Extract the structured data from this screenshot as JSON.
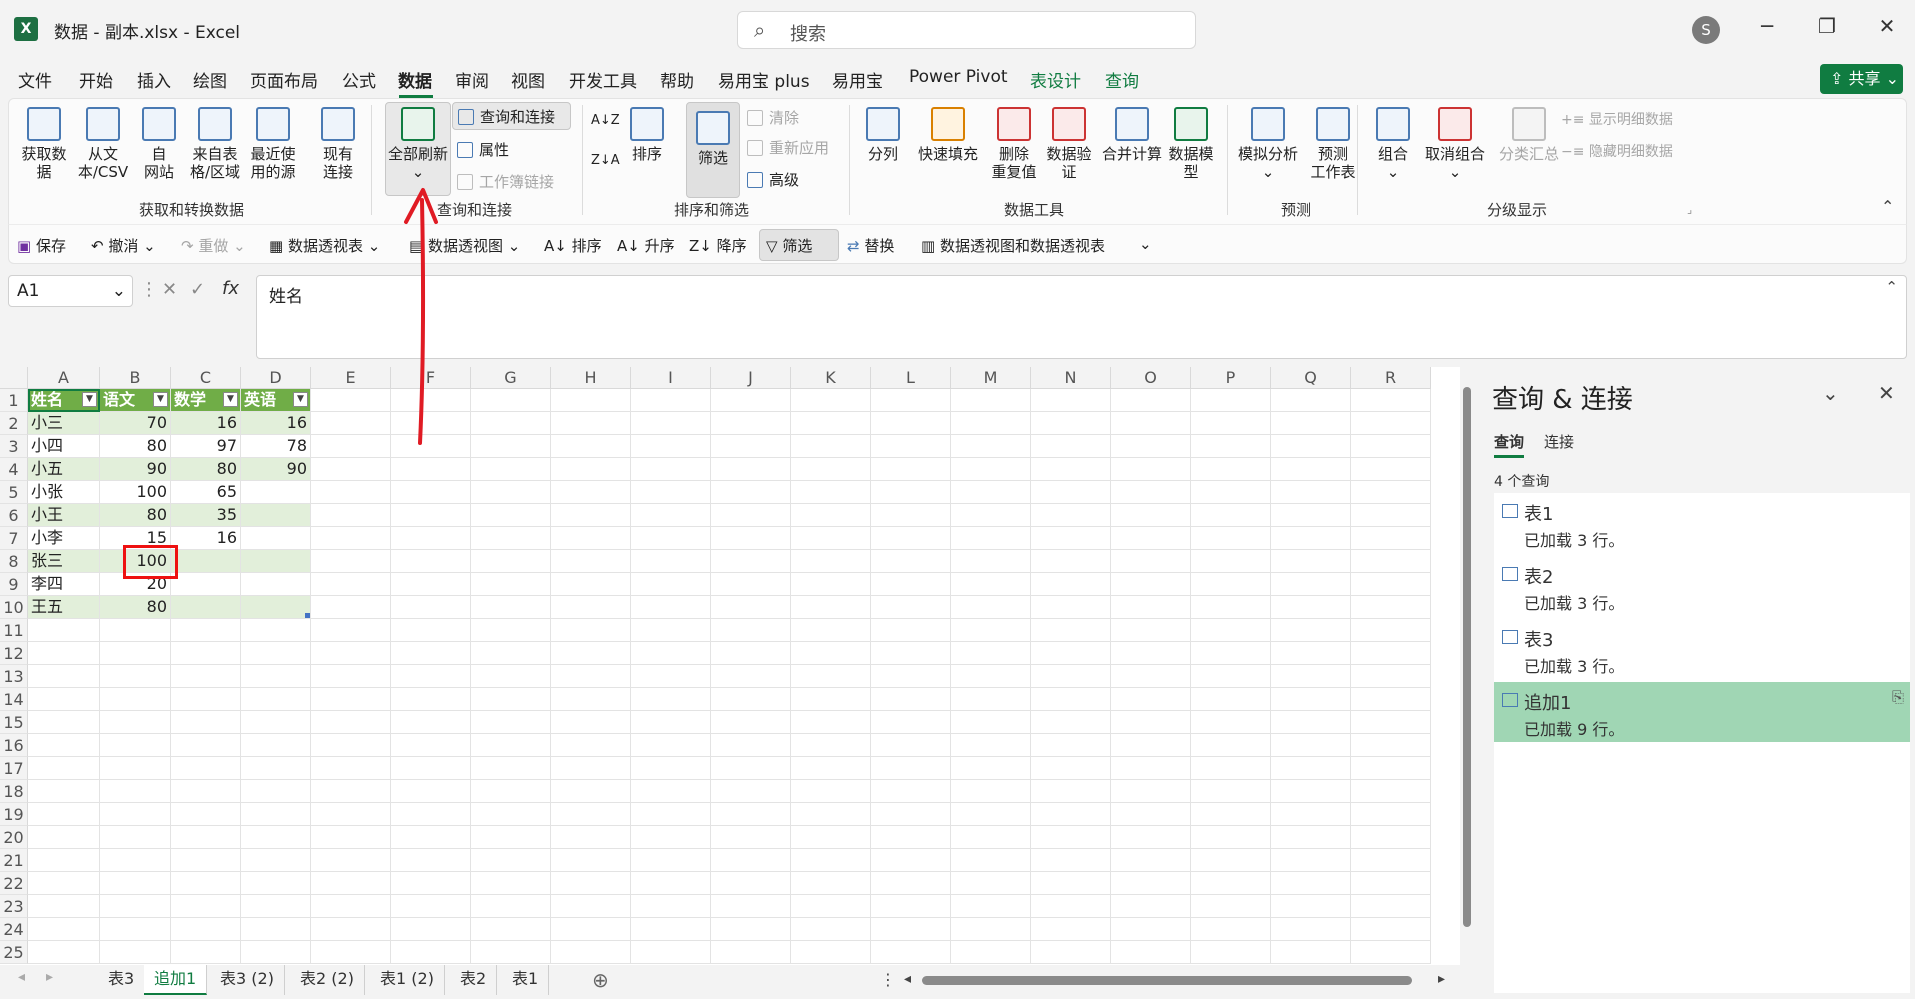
{
  "title_bar": {
    "app_logo": "X",
    "window_title": "数据 - 副本.xlsx  -  Excel",
    "search_placeholder": "搜索",
    "user_initial": "S",
    "minimize": "─",
    "restore": "❐",
    "close": "✕"
  },
  "menu": {
    "tabs": [
      "文件",
      "开始",
      "插入",
      "绘图",
      "页面布局",
      "公式",
      "数据",
      "审阅",
      "视图",
      "开发工具",
      "帮助",
      "易用宝 plus",
      "易用宝",
      "Power Pivot",
      "表设计",
      "查询"
    ],
    "active_tab": "数据",
    "share_label": "共享"
  },
  "ribbon": {
    "get_data": "获取数\n据",
    "from_text_csv": "从文\n本/CSV",
    "from_web": "自\n网站",
    "from_table": "来自表\n格/区域",
    "recent_sources": "最近使\n用的源",
    "existing_conn": "现有\n连接",
    "group_get": "获取和转换数据",
    "refresh_all": "全部刷新",
    "queries_connections": "查询和连接",
    "properties": "属性",
    "workbook_links": "工作簿链接",
    "group_query": "查询和连接",
    "sort": "排序",
    "filter": "筛选",
    "clear": "清除",
    "reapply": "重新应用",
    "advanced": "高级",
    "group_sort": "排序和筛选",
    "text_to_columns": "分列",
    "flash_fill": "快速填充",
    "remove_duplicates": "删除\n重复值",
    "data_validation": "数据验\n证",
    "consolidate": "合并计算",
    "data_model": "数据模\n型",
    "group_tools": "数据工具",
    "what_if": "模拟分析",
    "forecast_sheet": "预测\n工作表",
    "group_forecast": "预测",
    "group_btn": "组合",
    "ungroup_btn": "取消组合",
    "subtotal": "分类汇总",
    "show_detail": "显示明细数据",
    "hide_detail": "隐藏明细数据",
    "group_outline": "分级显示"
  },
  "qat": {
    "save": "保存",
    "undo": "撤消",
    "redo": "重做",
    "pivot_table": "数据透视表",
    "pivot_chart": "数据透视图",
    "sort": "排序",
    "sort_asc": "升序",
    "sort_desc": "降序",
    "filter": "筛选",
    "replace": "替换",
    "pivot_combo": "数据透视图和数据透视表"
  },
  "formula_bar": {
    "name_box": "A1",
    "fx": "fx",
    "content": "姓名"
  },
  "grid": {
    "columns": [
      "A",
      "B",
      "C",
      "D",
      "E",
      "F",
      "G",
      "H",
      "I",
      "J",
      "K",
      "L",
      "M",
      "N",
      "O",
      "P",
      "Q",
      "R"
    ],
    "row_numbers": [
      "1",
      "2",
      "3",
      "4",
      "5",
      "6",
      "7",
      "8",
      "9",
      "10",
      "11",
      "12",
      "13",
      "14",
      "15",
      "16",
      "17",
      "18",
      "19",
      "20",
      "21",
      "22",
      "23",
      "24",
      "25"
    ],
    "table_headers": [
      "姓名",
      "语文",
      "数学",
      "英语"
    ],
    "table_rows": [
      [
        "小三",
        "70",
        "16",
        "16"
      ],
      [
        "小四",
        "80",
        "97",
        "78"
      ],
      [
        "小五",
        "90",
        "80",
        "90"
      ],
      [
        "小张",
        "100",
        "65",
        ""
      ],
      [
        "小王",
        "80",
        "35",
        ""
      ],
      [
        "小李",
        "15",
        "16",
        ""
      ],
      [
        "张三",
        "100",
        "",
        ""
      ],
      [
        "李四",
        "20",
        "",
        ""
      ],
      [
        "王五",
        "80",
        "",
        ""
      ]
    ]
  },
  "sheets": {
    "tabs": [
      "表3",
      "追加1",
      "表3 (2)",
      "表2 (2)",
      "表1 (2)",
      "表2",
      "表1"
    ],
    "active": "追加1"
  },
  "queries_pane": {
    "title": "查询 & 连接",
    "tab_queries": "查询",
    "tab_connections": "连接",
    "count_label": "4 个查询",
    "items": [
      {
        "name": "表1",
        "status": "已加载 3 行。"
      },
      {
        "name": "表2",
        "status": "已加载 3 行。"
      },
      {
        "name": "表3",
        "status": "已加载 3 行。"
      },
      {
        "name": "追加1",
        "status": "已加载 9 行。"
      }
    ],
    "selected_index": 3
  }
}
